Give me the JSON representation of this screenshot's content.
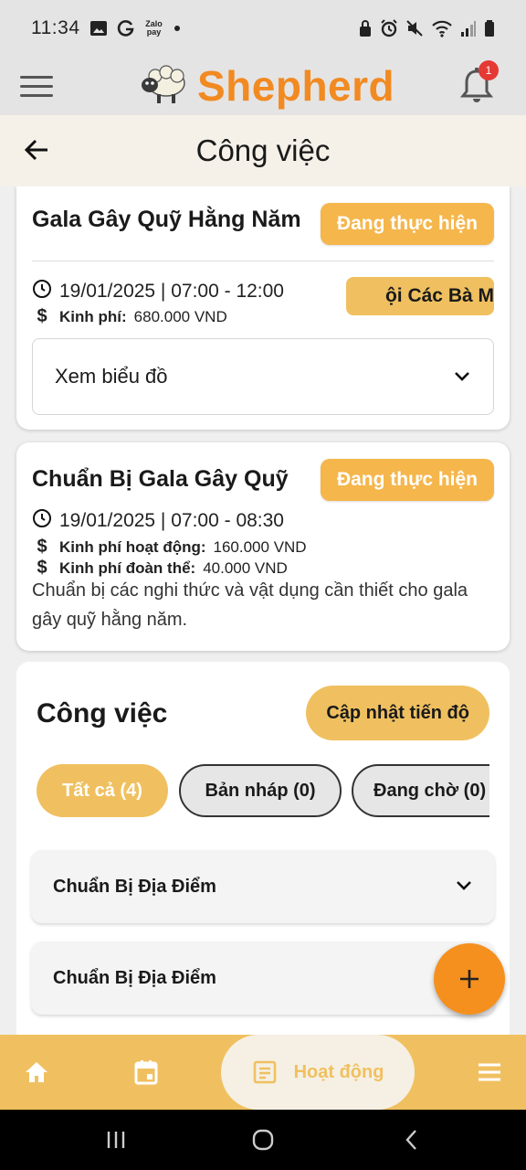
{
  "status_bar": {
    "time": "11:34",
    "left_icons": [
      "image-icon",
      "g-icon",
      "zalopay-icon",
      "dot-icon"
    ],
    "zalopay_label": "Zalo pay",
    "right_icons": [
      "lock-icon",
      "alarm-icon",
      "mute-icon",
      "wifi-icon",
      "signal-icon",
      "battery-icon"
    ]
  },
  "app_bar": {
    "app_name": "Shepherd",
    "notification_count": "1",
    "colors": {
      "brand": "#f28a22",
      "badge": "#e53935"
    }
  },
  "header": {
    "title": "Công việc"
  },
  "event_card": {
    "title": "Gala Gây Quỹ Hằng Năm",
    "status": "Đang thực hiện",
    "datetime": "19/01/2025 | 07:00 - 12:00",
    "budget_label": "Kinh phí:",
    "budget_value": "680.000 VND",
    "organization_tag": "ội Các Bà M",
    "chart_toggle_label": "Xem biểu đồ"
  },
  "activity_card": {
    "title": "Chuẩn Bị Gala Gây Quỹ",
    "status": "Đang thực hiện",
    "datetime": "19/01/2025 | 07:00 - 08:30",
    "activity_budget_label": "Kinh phí hoạt động:",
    "activity_budget_value": "160.000 VND",
    "union_budget_label": "Kinh phí đoàn thể:",
    "union_budget_value": "40.000 VND",
    "description": "Chuẩn bị các nghi thức và vật dụng cần thiết cho gala gây quỹ hằng năm."
  },
  "tasks_section": {
    "title": "Công việc",
    "update_button": "Cập nhật tiến độ",
    "filters": [
      {
        "label": "Tất cả (4)",
        "active": true
      },
      {
        "label": "Bản nháp (0)",
        "active": false
      },
      {
        "label": "Đang chờ (0)",
        "active": false
      }
    ],
    "tasks": [
      {
        "title": "Chuẩn Bị Địa Điểm"
      },
      {
        "title": "Chuẩn Bị Địa Điểm"
      }
    ]
  },
  "bottom_nav": {
    "items": [
      "home-icon",
      "calendar-icon",
      "activity-icon",
      "menu-icon"
    ],
    "active_label": "Hoạt động",
    "colors": {
      "bar": "#f0c060",
      "active_bg": "#f5f0e3"
    }
  },
  "system_nav": {
    "buttons": [
      "recents",
      "home",
      "back"
    ]
  }
}
